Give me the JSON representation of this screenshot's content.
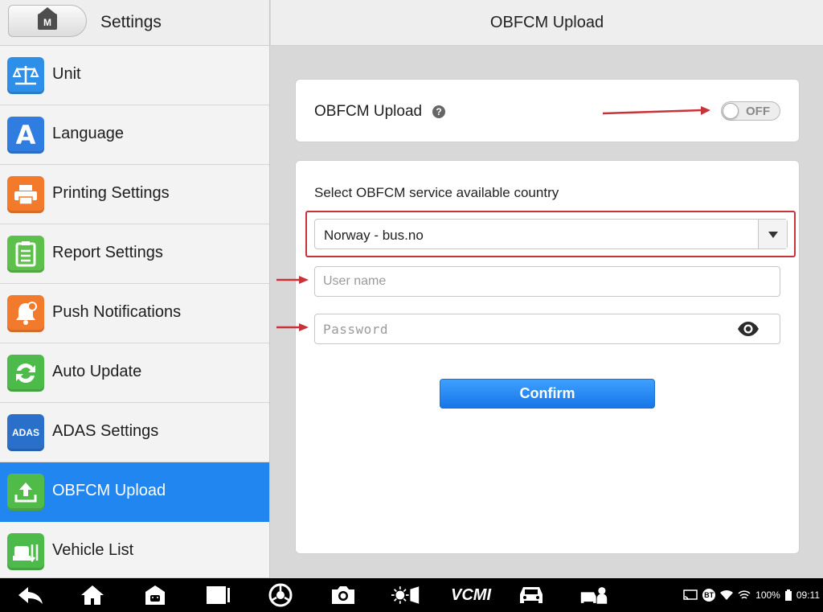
{
  "sidebar": {
    "title": "Settings",
    "home_letter": "M",
    "items": [
      {
        "label": "Unit",
        "icon": "scale-icon",
        "color": "#2e8fe8"
      },
      {
        "label": "Language",
        "icon": "language-icon",
        "color": "#2f7de0"
      },
      {
        "label": "Printing Settings",
        "icon": "printer-icon",
        "color": "#f37a2a"
      },
      {
        "label": "Report Settings",
        "icon": "report-icon",
        "color": "#5cc04a"
      },
      {
        "label": "Push Notifications",
        "icon": "bell-icon",
        "color": "#f17a2c"
      },
      {
        "label": "Auto Update",
        "icon": "update-icon",
        "color": "#4cbb4a"
      },
      {
        "label": "ADAS Settings",
        "icon": "adas-icon",
        "color": "#2a6fc9",
        "text": "ADAS"
      },
      {
        "label": "OBFCM Upload",
        "icon": "upload-icon",
        "color": "#51bb4a",
        "active": true
      },
      {
        "label": "Vehicle List",
        "icon": "vehicle-list-icon",
        "color": "#4cbb4a"
      }
    ]
  },
  "main": {
    "title": "OBFCM Upload",
    "toggle_card": {
      "label": "OBFCM Upload",
      "help": "?",
      "toggle_state": "OFF"
    },
    "form": {
      "country_label": "Select OBFCM service available country",
      "country_value": "Norway - bus.no",
      "username_placeholder": "User name",
      "password_placeholder": "Password",
      "confirm_label": "Confirm"
    }
  },
  "navbar": {
    "vcmi_label": "VCMI",
    "battery": "100%",
    "time": "09:11",
    "bt_label": "BT"
  },
  "colors": {
    "accent": "#2186f0",
    "annotation": "#c8333a"
  }
}
